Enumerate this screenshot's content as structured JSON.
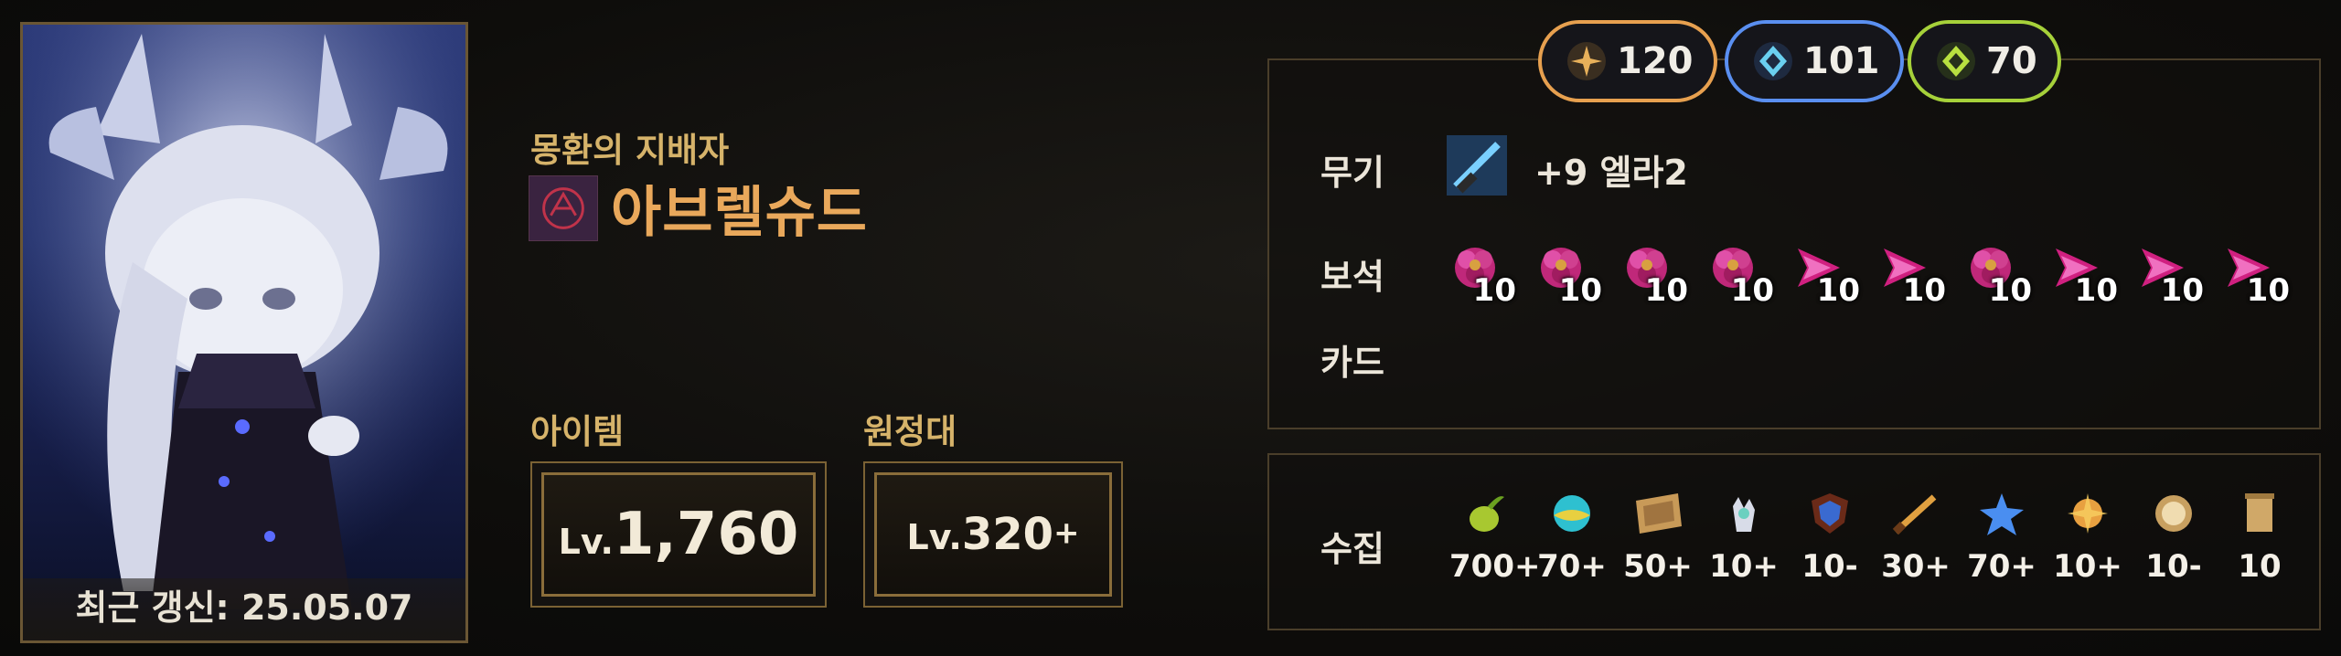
{
  "profile": {
    "updated": "최근 갱신: 25.05.07",
    "title": "몽환의 지배자",
    "name": "아브렐슈드"
  },
  "stats": {
    "item_label": "아이템",
    "item_prefix": "Lv.",
    "item_value": "1,760",
    "expedition_label": "원정대",
    "expedition_prefix": "Lv.",
    "expedition_value": "320",
    "expedition_suffix": "+"
  },
  "pills": [
    {
      "value": "120",
      "color": "#e7a04f"
    },
    {
      "value": "101",
      "color": "#5a8ff0"
    },
    {
      "value": "70",
      "color": "#a6d13a"
    }
  ],
  "equipment": {
    "weapon_label": "무기",
    "weapon_value": "+9 엘라2",
    "gem_label": "보석",
    "card_label": "카드",
    "gems": [
      {
        "level": "10",
        "icon": "gem-flower-icon"
      },
      {
        "level": "10",
        "icon": "gem-flower-icon"
      },
      {
        "level": "10",
        "icon": "gem-flower-icon"
      },
      {
        "level": "10",
        "icon": "gem-flower-icon"
      },
      {
        "level": "10",
        "icon": "gem-arrow-icon"
      },
      {
        "level": "10",
        "icon": "gem-arrow-icon"
      },
      {
        "level": "10",
        "icon": "gem-flower-icon"
      },
      {
        "level": "10",
        "icon": "gem-arrow-icon"
      },
      {
        "level": "10",
        "icon": "gem-arrow-icon"
      },
      {
        "level": "10",
        "icon": "gem-arrow-icon"
      }
    ]
  },
  "collection": {
    "label": "수집",
    "items": [
      {
        "value": "700+",
        "icon": "mokoko-seed-icon"
      },
      {
        "value": "70+",
        "icon": "island-heart-icon"
      },
      {
        "value": "50+",
        "icon": "map-icon"
      },
      {
        "value": "10+",
        "icon": "hand-icon"
      },
      {
        "value": "10-",
        "icon": "shield-icon"
      },
      {
        "value": "30+",
        "icon": "sword-icon"
      },
      {
        "value": "70+",
        "icon": "star-icon"
      },
      {
        "value": "10+",
        "icon": "orb-icon"
      },
      {
        "value": "10-",
        "icon": "medal-icon"
      },
      {
        "value": "10",
        "icon": "scroll-icon"
      }
    ]
  }
}
